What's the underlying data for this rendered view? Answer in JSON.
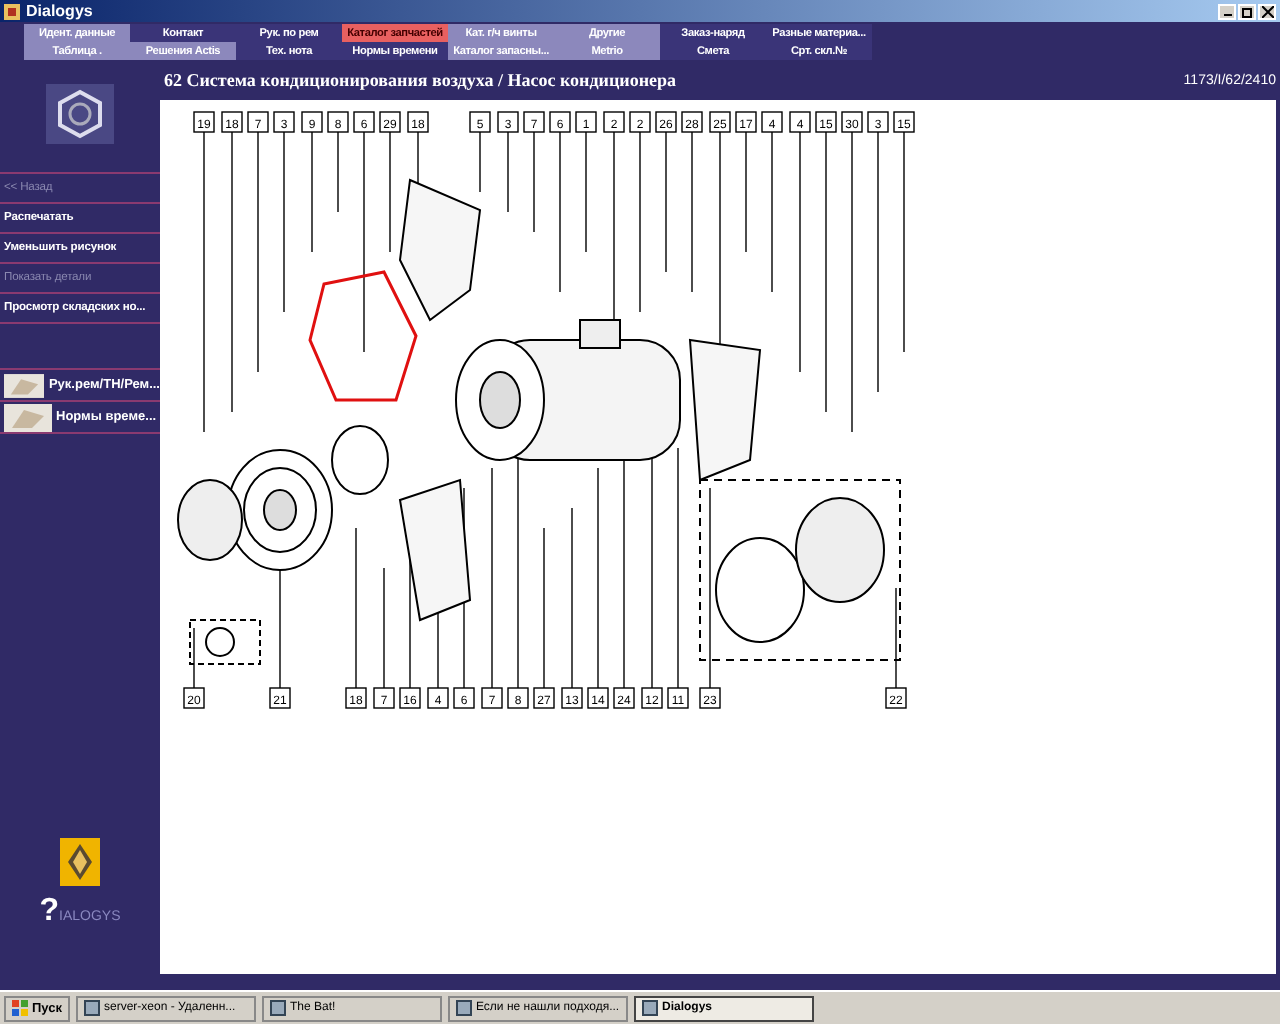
{
  "window": {
    "title": "Dialogys"
  },
  "nav": [
    {
      "label": "Идент. данные",
      "kind": "light",
      "selected": false
    },
    {
      "label": "Контакт",
      "kind": "dark",
      "selected": false
    },
    {
      "label": "Рук. по рем",
      "kind": "dark",
      "selected": false
    },
    {
      "label": "Каталог запчастей",
      "kind": "light",
      "selected": true
    },
    {
      "label": "Кат. г/ч винты",
      "kind": "light",
      "selected": false
    },
    {
      "label": "Другие",
      "kind": "light",
      "selected": false
    },
    {
      "label": "Заказ-наряд",
      "kind": "dark",
      "selected": false
    },
    {
      "label": "Разные материа...",
      "kind": "dark",
      "selected": false
    },
    {
      "label": "Таблица .",
      "kind": "light",
      "selected": false
    },
    {
      "label": "Решения Actis",
      "kind": "light",
      "selected": false
    },
    {
      "label": "Тех. нота",
      "kind": "dark",
      "selected": false
    },
    {
      "label": "Нормы времени",
      "kind": "dark",
      "selected": false
    },
    {
      "label": "Каталог запасны...",
      "kind": "light",
      "selected": false
    },
    {
      "label": "Metrio",
      "kind": "light",
      "selected": false
    },
    {
      "label": "Смета",
      "kind": "dark",
      "selected": false
    },
    {
      "label": "Срт. скл.№",
      "kind": "dark",
      "selected": false
    }
  ],
  "sidebar": {
    "items": [
      {
        "label": "<< Назад",
        "disabled": true
      },
      {
        "label": "Распечатать",
        "disabled": false
      },
      {
        "label": "Уменьшить рисунок",
        "disabled": false
      },
      {
        "label": "Показать детали",
        "disabled": true
      },
      {
        "label": "Просмотр складских но...",
        "disabled": false
      }
    ],
    "shortcuts": [
      {
        "label": "Рук.рем/ТН/Рем..."
      },
      {
        "label": "Нормы време..."
      }
    ],
    "logo_mark": "?",
    "logo_text": "IALOGYS"
  },
  "header": {
    "title": "62 Система кондиционирования воздуха / Насос кондиционера",
    "reference": "1173/I/62/2410"
  },
  "diagram": {
    "top_callouts": [
      "19",
      "18",
      "7",
      "3",
      "9",
      "8",
      "6",
      "29",
      "18",
      "5",
      "3",
      "7",
      "6",
      "1",
      "2",
      "2",
      "26",
      "28",
      "25",
      "17",
      "4",
      "4",
      "15",
      "30",
      "3",
      "15"
    ],
    "bottom_callouts": [
      "20",
      "21",
      "18",
      "7",
      "16",
      "4",
      "6",
      "7",
      "8",
      "27",
      "13",
      "14",
      "24",
      "12",
      "11",
      "23",
      "22"
    ]
  },
  "taskbar": {
    "start": "Пуск",
    "tasks": [
      {
        "label": "server-xeon - Удаленн...",
        "selected": false
      },
      {
        "label": "The Bat!",
        "selected": false
      },
      {
        "label": "Если не нашли подходя...",
        "selected": false
      },
      {
        "label": "Dialogys",
        "selected": true
      }
    ]
  }
}
